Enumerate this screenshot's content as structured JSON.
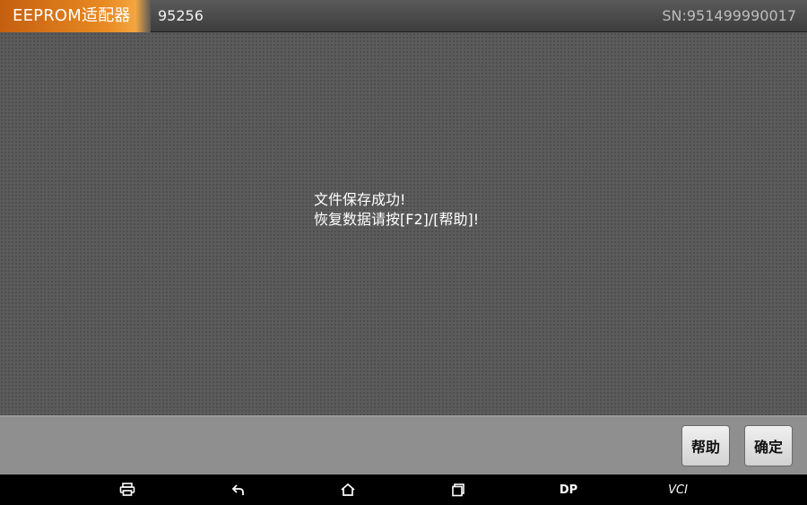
{
  "header": {
    "app_title": "EEPROM适配器",
    "module_id": "95256",
    "serial": "SN:951499990017"
  },
  "message": {
    "line1": "文件保存成功!",
    "line2": "恢复数据请按[F2]/[帮助]!"
  },
  "buttons": {
    "help_label": "帮助",
    "ok_label": "确定"
  },
  "navbar": {
    "icons": [
      "print-icon",
      "back-icon",
      "home-icon",
      "recent-apps-icon"
    ],
    "dp_label": "DP",
    "vci_label": "VCI"
  },
  "colors": {
    "accent": "#e98a22",
    "background": "#5b5b5b",
    "actionbar": "#8f8f8f"
  }
}
